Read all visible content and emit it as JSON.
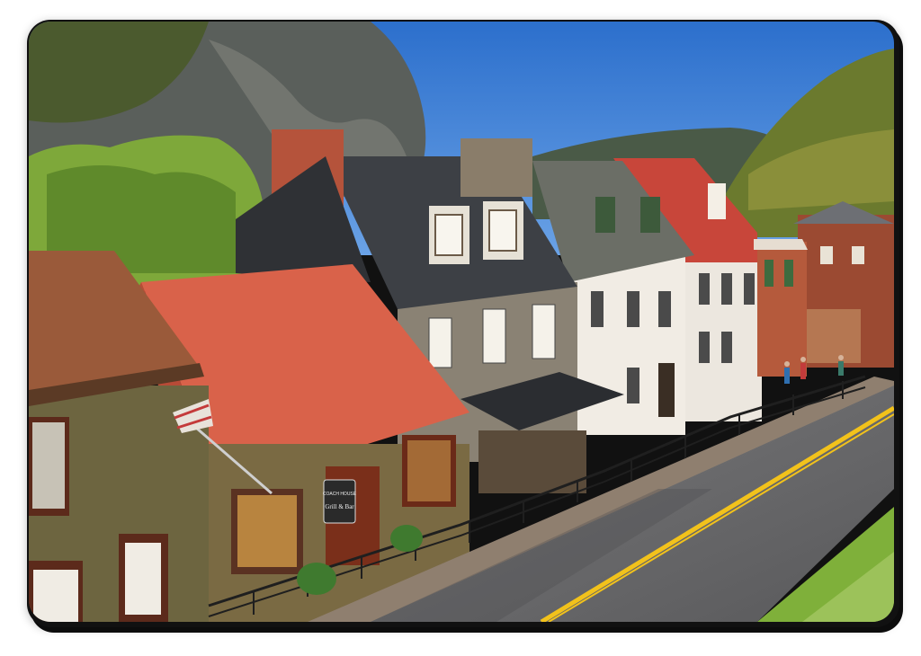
{
  "photo": {
    "description_kind": "street-photo",
    "palette": {
      "sky": "#2f78d2",
      "red_roof": "#d9624a",
      "dark_roof": "#3a3d42",
      "road": "#6d6d6f",
      "center_line": "#f2c21b"
    }
  },
  "signs": {
    "hanging_sign_line1": "COACH HOUSE",
    "hanging_sign_line2": "Grill & Bar"
  }
}
